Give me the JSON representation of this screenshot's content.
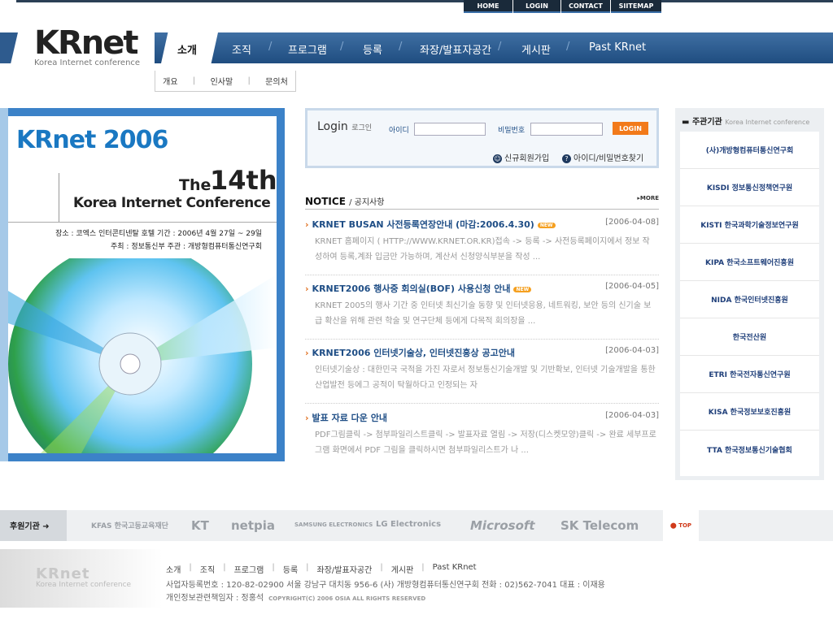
{
  "topnav": [
    "HOME",
    "LOGIN",
    "CONTACT",
    "SIITEMAP"
  ],
  "logo": {
    "big": "KRnet",
    "small": "Korea Internet conference"
  },
  "menu": {
    "active": "소개",
    "items": [
      "조직",
      "프로그램",
      "등록",
      "좌장/발표자공간",
      "게시판",
      "Past KRnet"
    ]
  },
  "submenu": [
    "개요",
    "인사말",
    "문의처"
  ],
  "poster": {
    "title": "KRnet 2006",
    "the": "The",
    "num": "14th",
    "conf": "Korea Internet Conference",
    "info1": "장소 : 코엑스 인터콘티넨탈 호텔  기간 : 2006년 4월 27일 ~ 29일",
    "info2": "주최 : 정보통신부  주관 : 개방형컴퓨터통신연구회"
  },
  "login": {
    "title": "Login",
    "title_sub": "로그인",
    "id_label": "아이디",
    "pw_label": "비밀번호",
    "button": "LOGIN",
    "join": "신규회원가입",
    "find": "아이디/비밀번호찾기"
  },
  "notice": {
    "header": "NOTICE",
    "header_sub": "/ 공지사항",
    "more": "MORE",
    "items": [
      {
        "title": "KRNET BUSAN 사전등록연장안내 (마감:2006.4.30)",
        "new": "NEW",
        "date": "[2006-04-08]",
        "body": "KRNET 홈페이지 ( HTTP://WWW.KRNET.OR.KR)접속 -> 등록 -> 사전등록페이지에서 정보 작성하여 등록,계좌 입금만 가능하며, 계산서 신청양식부분을 작성 ..."
      },
      {
        "title": "KRNET2006 행사중 회의실(BOF) 사용신청 안내",
        "new": "NEW",
        "date": "[2006-04-05]",
        "body": "KRNET 2005의 행사 기간 중 인터넷 최신기술 동향 및 인터넷응용, 네트워킹, 보안 등의 신기술 보급 확산을 위해 관련 학술 및 연구단체 등에게 다목적  회의장을 ..."
      },
      {
        "title": "KRNET2006 인터넷기술상, 인터넷진흥상 공고안내",
        "new": "",
        "date": "[2006-04-03]",
        "body": "인터넷기술상 :  대한민국 국적을 가진 자로서 정보통신기술개발  및 기반확보, 인터넷  기술개발을 통한 산업발전 등에그 공적이 탁월하다고 인정되는 자"
      },
      {
        "title": "발표 자료 다운 안내",
        "new": "",
        "date": "[2006-04-03]",
        "body": "PDF그림클릭 -> 첨부파일리스트클릭 -> 발표자료 열림 -> 저장(디스켓모양)클릭 -> 완료 세부프로그램 화면에서 PDF 그림을 클릭하시면 첨부파일리스트가 나 ..."
      }
    ]
  },
  "host": {
    "header": "주관기관",
    "header_sub": "Korea Internet conference",
    "items": [
      "(사)개방형컴퓨터통신연구회",
      "KISDI 정보통신정책연구원",
      "KISTI 한국과학기술정보연구원",
      "KIPA 한국소프트웨어진흥원",
      "NIDA 한국인터넷진흥원",
      "한국전산원",
      "ETRI 한국전자통신연구원",
      "KISA 한국정보보호진흥원",
      "TTA 한국정보통신기술협회"
    ]
  },
  "sponsor": {
    "label": "후원기관",
    "items": [
      "KFAS 한국고등교육재단",
      "KT",
      "netpia",
      "SAMSUNG ELECTRONICS",
      "LG Electronics",
      "Microsoft",
      "SK Telecom"
    ],
    "top": "TOP"
  },
  "footer": {
    "logo_big": "KRnet",
    "logo_small": "Korea Internet conference",
    "nav": [
      "소개",
      "조직",
      "프로그램",
      "등록",
      "좌장/발표자공간",
      "게시판",
      "Past KRnet"
    ],
    "info1": "사업자등록번호 : 120-82-02900 서울 강남구 대치동 956-6 (사) 개방형컴퓨터통신연구회 전화 : 02)562-7041 대표 : 이재용",
    "info2": "개인정보관련책임자 : 정홍석",
    "copyright": "COPYRIGHT(C) 2006 OSIA ALL RIGHTS RESERVED"
  }
}
